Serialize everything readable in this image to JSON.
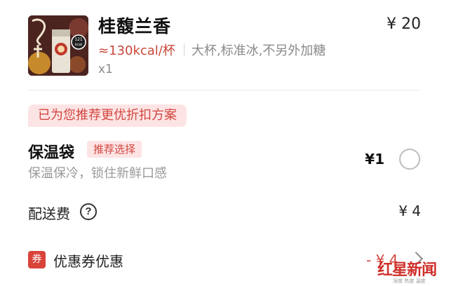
{
  "product": {
    "name": "桂馥兰香",
    "calories": "≈130kcal/杯",
    "specs": "大杯,标准冰,不另外加糖",
    "quantity": "x1",
    "price": "¥ 20",
    "thumbnail_text": "121 kcal"
  },
  "banner": {
    "text": "已为您推荐更优折扣方案"
  },
  "thermal_bag": {
    "title": "保温袋",
    "tag": "推荐选择",
    "description": "保温保冷，锁住新鲜口感",
    "price": "¥1",
    "selected": false
  },
  "delivery": {
    "label": "配送费",
    "help_icon": "question-circle-icon",
    "price": "¥ 4"
  },
  "coupon": {
    "badge": "券",
    "label": "优惠券优惠",
    "amount": "- ¥ 4",
    "chevron_icon": "chevron-right-icon"
  },
  "watermark": {
    "brand": "红星新闻",
    "sub": "深度 热度 温度"
  },
  "colors": {
    "accent_red": "#d2463f",
    "banner_bg": "#fde4e4",
    "muted_text": "#8a8a8a",
    "divider": "#ececec"
  }
}
